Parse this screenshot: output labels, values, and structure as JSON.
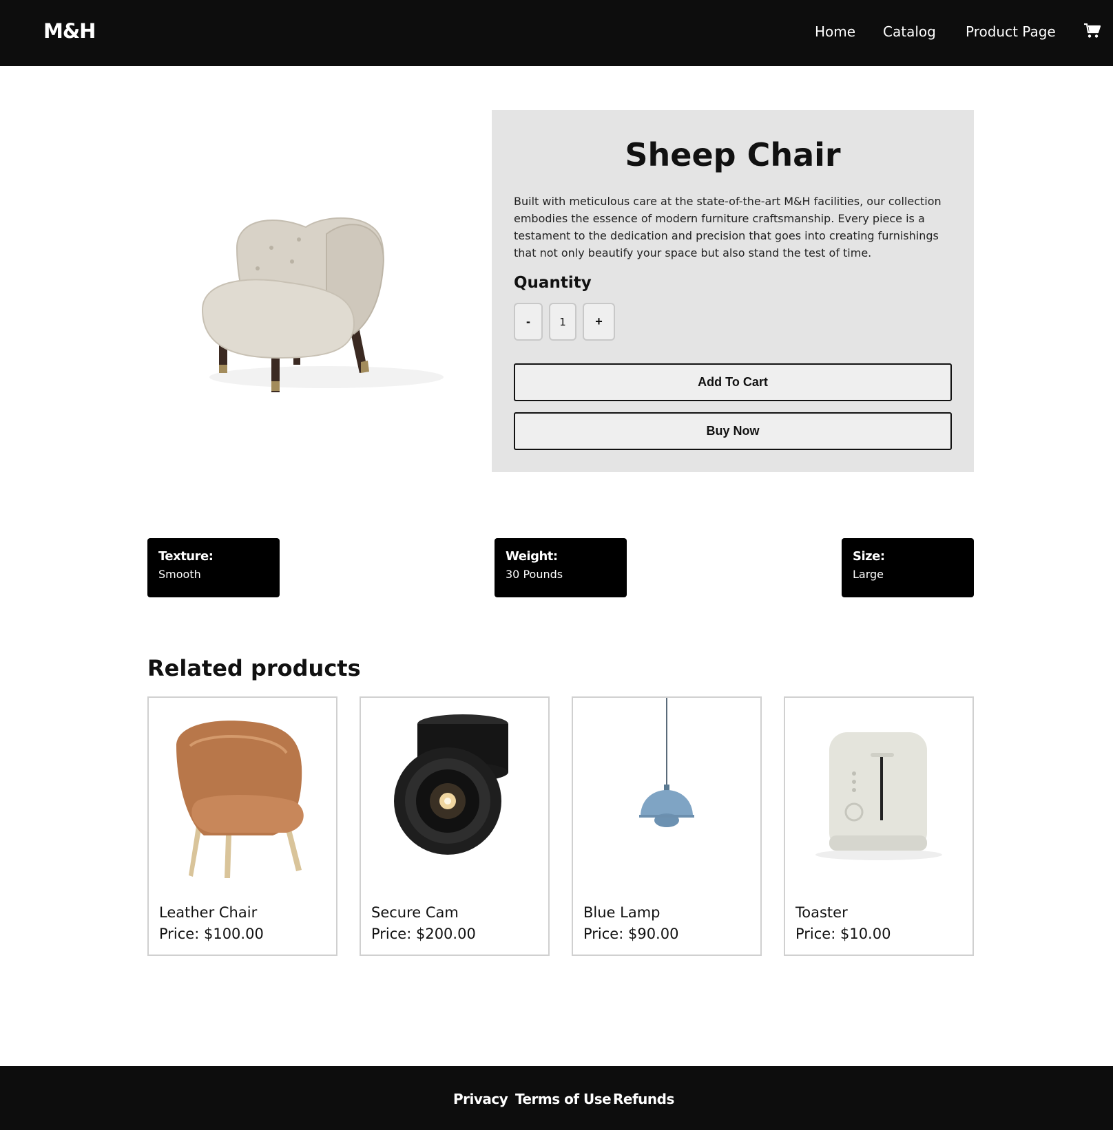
{
  "header": {
    "logo": "M&H",
    "nav": [
      "Home",
      "Catalog",
      "Product Page"
    ],
    "cart_icon": "cart-icon"
  },
  "product": {
    "title": "Sheep Chair",
    "description": "Built with meticulous care at the state-of-the-art M&H facilities, our collection embodies the essence of modern furniture craftsmanship. Every piece is a testament to the dedication and precision that goes into creating furnishings that not only beautify your space but also stand the test of time.",
    "quantity_label": "Quantity",
    "qty_minus": "-",
    "qty_value": "1",
    "qty_plus": "+",
    "add_to_cart": "Add To Cart",
    "buy_now": "Buy Now"
  },
  "attributes": [
    {
      "label": "Texture:",
      "value": "Smooth"
    },
    {
      "label": "Weight:",
      "value": "30 Pounds"
    },
    {
      "label": "Size:",
      "value": "Large"
    }
  ],
  "related": {
    "title": "Related products",
    "items": [
      {
        "name": "Leather Chair",
        "price": "Price: $100.00"
      },
      {
        "name": "Secure Cam",
        "price": "Price: $200.00"
      },
      {
        "name": "Blue Lamp",
        "price": "Price: $90.00"
      },
      {
        "name": "Toaster",
        "price": "Price: $10.00"
      }
    ]
  },
  "footer": {
    "links": [
      "Privacy",
      "Terms of Use",
      "Refunds"
    ]
  },
  "colors": {
    "header_bg": "#0d0d0d",
    "panel_bg": "#e4e4e4",
    "attr_bg": "#000000"
  }
}
